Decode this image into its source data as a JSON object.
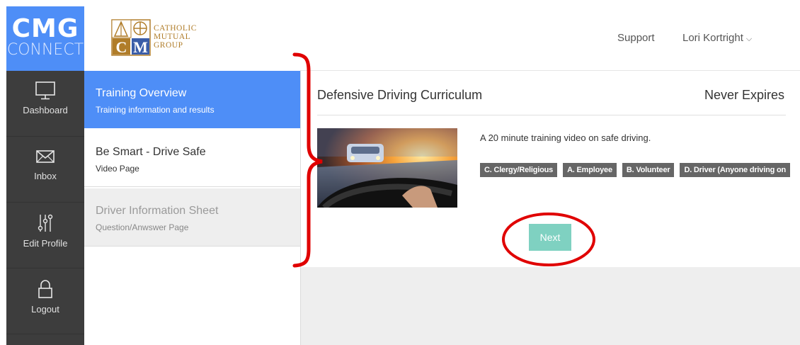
{
  "brand": {
    "line1": "CMG",
    "line2": "CONNECT",
    "color": "#4e8ef7"
  },
  "logo": {
    "line1": "CATHOLIC",
    "line2": "MUTUAL",
    "line3": "GROUP",
    "letters": "CM",
    "color": "#b07d2a"
  },
  "rail": {
    "items": [
      {
        "label": "Dashboard",
        "icon": "monitor-icon"
      },
      {
        "label": "Inbox",
        "icon": "envelope-icon"
      },
      {
        "label": "Edit Profile",
        "icon": "sliders-icon"
      },
      {
        "label": "Logout",
        "icon": "lock-icon"
      }
    ]
  },
  "header": {
    "support": "Support",
    "user": "Lori Kortright",
    "user_icon": "chevron-down-icon",
    "chevron": "⌵"
  },
  "steps": [
    {
      "title": "Training Overview",
      "subtitle": "Training information and results",
      "state": "active"
    },
    {
      "title": "Be Smart - Drive Safe",
      "subtitle": "Video Page",
      "state": "normal"
    },
    {
      "title": "Driver Information Sheet",
      "subtitle": "Question/Anwswer Page",
      "state": "disabled"
    }
  ],
  "course": {
    "title": "Defensive Driving Curriculum",
    "expires": "Never Expires",
    "description": "A 20 minute training video on safe driving.",
    "tags": [
      "C. Clergy/Religious",
      "A. Employee",
      "B. Volunteer",
      "D. Driver (Anyone driving on"
    ],
    "next_label": "Next"
  },
  "colors": {
    "accent": "#4e8ef7",
    "next_button": "#7fd1c1",
    "annotation": "#e00000",
    "tag_bg": "#666666"
  }
}
